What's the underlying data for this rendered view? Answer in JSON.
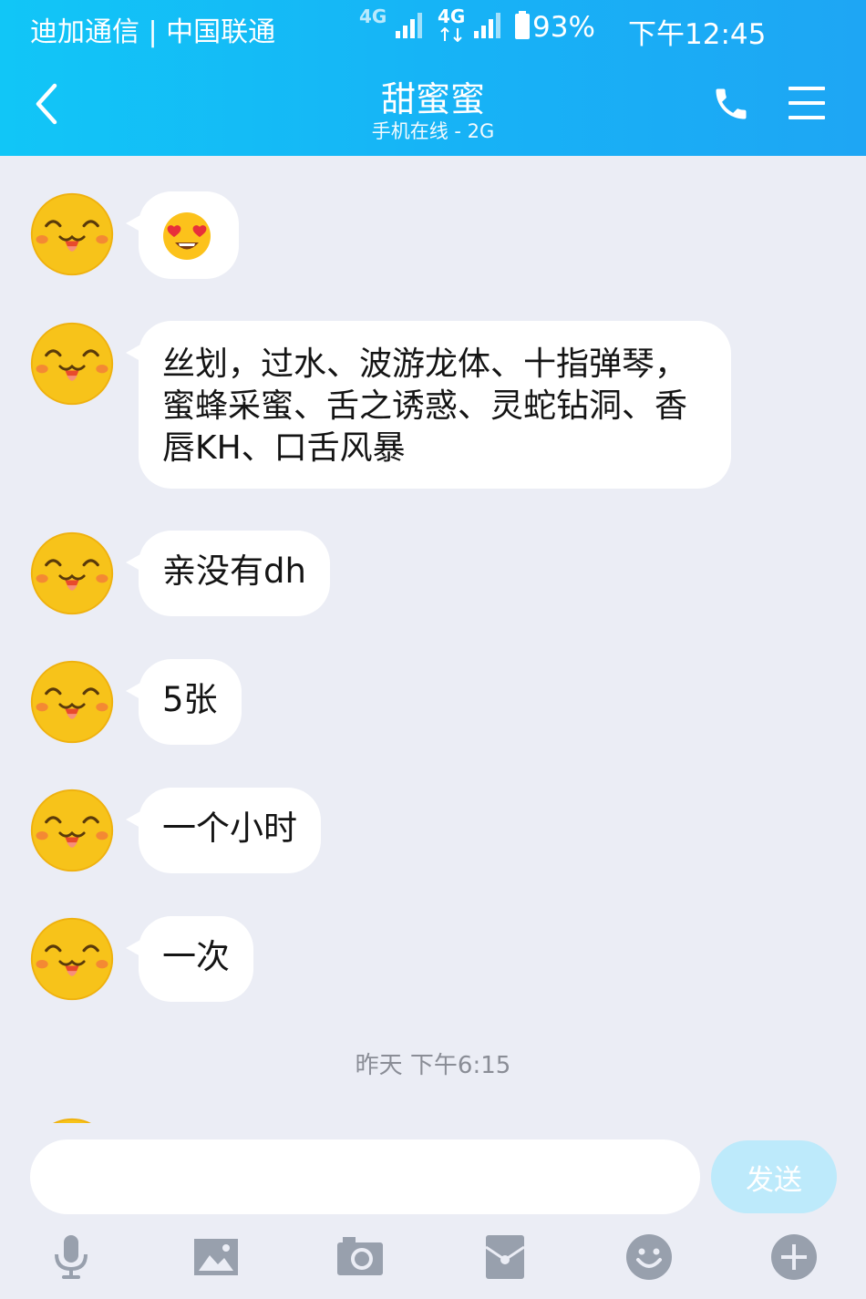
{
  "status_bar": {
    "carrier": "迪加通信 | 中国联通",
    "network_1": "4G",
    "network_2": "4G",
    "battery": "93%",
    "time": "下午12:45"
  },
  "header": {
    "title": "甜蜜蜜",
    "subtitle": "手机在线 - 2G"
  },
  "messages": [
    {
      "text": "😍",
      "emoji_icon": "heart-eyes-emoji"
    },
    {
      "text": "丝划，过水、波游龙体、十指弹琴，蜜蜂采蜜、舌之诱惑、灵蛇钻洞、香唇KH、口舌风暴"
    },
    {
      "text": "亲没有dh"
    },
    {
      "text": "5张"
    },
    {
      "text": "一个小时"
    },
    {
      "text": "一次"
    }
  ],
  "timestamp": "昨天 下午6:15",
  "input": {
    "value": "",
    "placeholder": ""
  },
  "send_label": "发送",
  "toolbar": [
    "microphone-icon",
    "image-icon",
    "camera-icon",
    "red-packet-icon",
    "smiley-icon",
    "plus-icon"
  ],
  "colors": {
    "header_start": "#11c6f7",
    "header_end": "#1ea6f4",
    "background": "#ebedf5",
    "send_button": "#bdeafb"
  }
}
